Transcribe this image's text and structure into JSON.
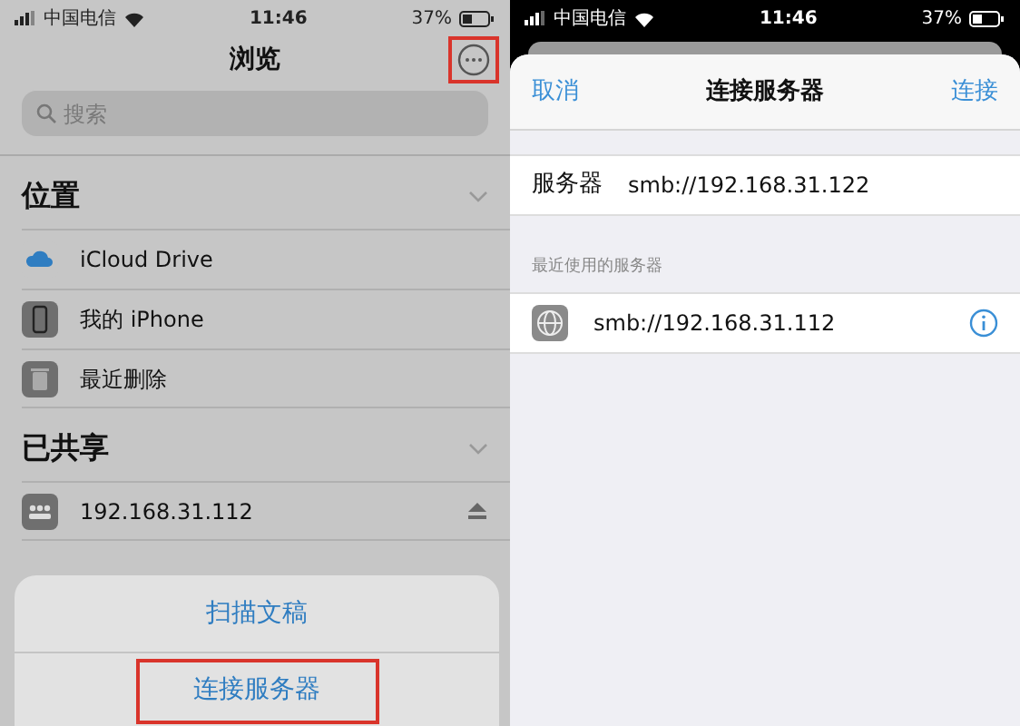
{
  "browse_screen": {
    "status_bar": {
      "carrier": "中国电信",
      "time": "11:46",
      "battery": "37%"
    },
    "title": "浏览",
    "more_button": {
      "highlighted": true
    },
    "search": {
      "placeholder": "搜索"
    },
    "sections": [
      {
        "heading": "位置",
        "expanded": true,
        "items": [
          {
            "kind": "icloud",
            "label": "iCloud Drive"
          },
          {
            "kind": "phone",
            "label": "我的 iPhone"
          },
          {
            "kind": "trash",
            "label": "最近删除"
          }
        ]
      },
      {
        "heading": "已共享",
        "expanded": true,
        "items": [
          {
            "kind": "server",
            "label": "192.168.31.112",
            "ejectable": true
          }
        ]
      }
    ],
    "action_sheet": [
      {
        "label": "扫描文稿",
        "highlighted": false
      },
      {
        "label": "连接服务器",
        "highlighted": true
      }
    ]
  },
  "connect_screen": {
    "status_bar": {
      "carrier": "中国电信",
      "time": "11:46",
      "battery": "37%"
    },
    "cancel": "取消",
    "title": "连接服务器",
    "connect": "连接",
    "server_field": {
      "label": "服务器",
      "value": "smb://192.168.31.122"
    },
    "recent_heading": "最近使用的服务器",
    "recent_servers": [
      {
        "address": "smb://192.168.31.112"
      }
    ]
  }
}
